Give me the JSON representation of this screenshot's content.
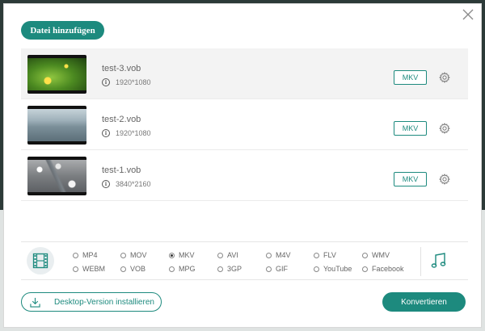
{
  "toolbar": {
    "add_label": "Datei hinzufügen"
  },
  "files": [
    {
      "name": "test-3.vob",
      "resolution": "1920*1080",
      "format": "MKV",
      "thumb": "green-flower",
      "selected": true
    },
    {
      "name": "test-2.vob",
      "resolution": "1920*1080",
      "format": "MKV",
      "thumb": "sea"
    },
    {
      "name": "test-1.vob",
      "resolution": "3840*2160",
      "format": "MKV",
      "thumb": "snow-forest"
    }
  ],
  "formats": {
    "row1": [
      "MP4",
      "MOV",
      "MKV",
      "AVI",
      "M4V",
      "FLV",
      "WMV"
    ],
    "row2": [
      "WEBM",
      "VOB",
      "MPG",
      "3GP",
      "GIF",
      "YouTube",
      "Facebook"
    ],
    "selected": "MKV"
  },
  "footer": {
    "desktop_label": "Desktop-Version installieren",
    "convert_label": "Konvertieren"
  },
  "colors": {
    "accent": "#1d8a7e"
  },
  "icons": {
    "close": "close-icon",
    "info": "info-icon",
    "settings": "gear-icon",
    "video": "film-icon",
    "audio": "music-note-icon",
    "download": "download-icon"
  }
}
